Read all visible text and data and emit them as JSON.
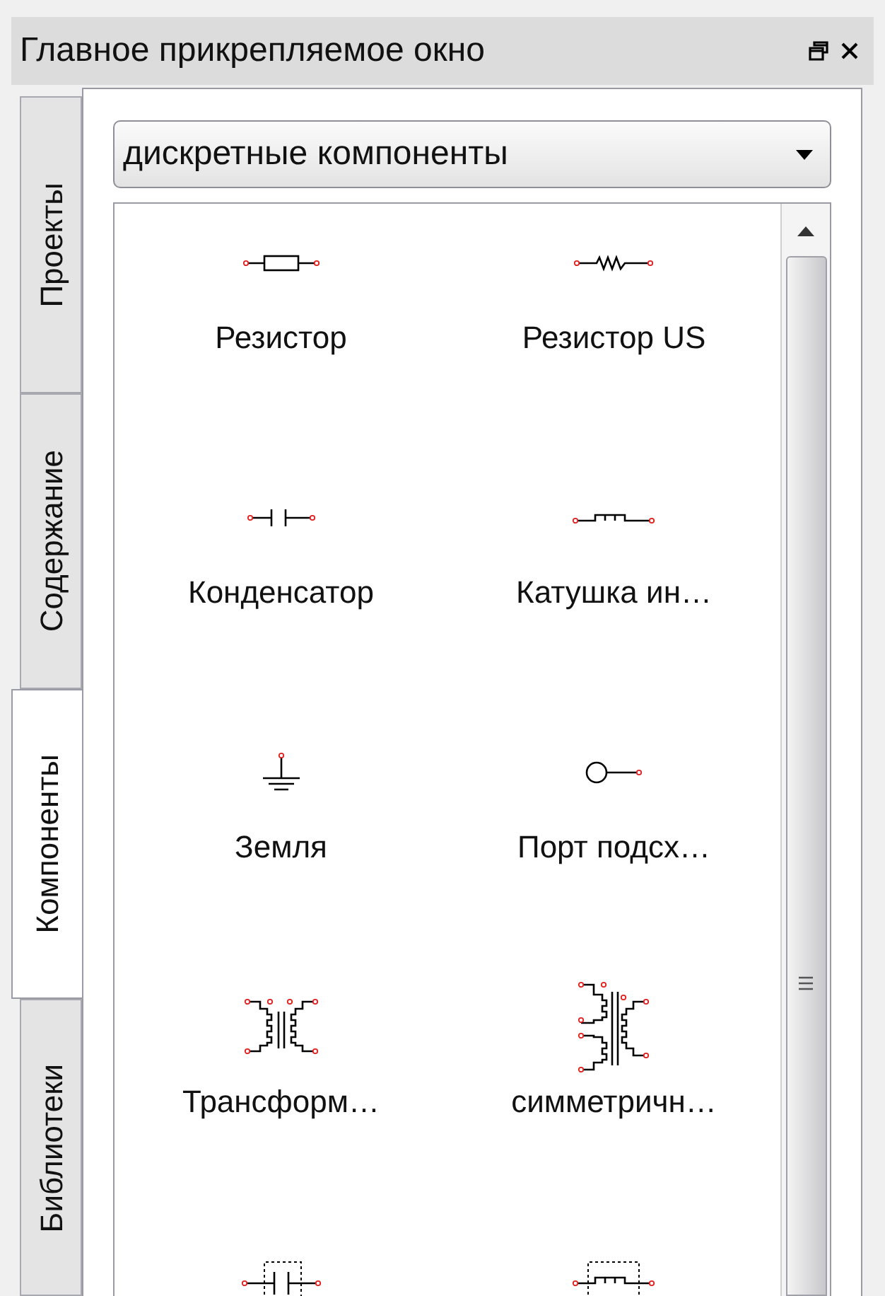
{
  "window": {
    "title": "Главное прикрепляемое окно"
  },
  "tabs": [
    {
      "label": "Проекты",
      "selected": false
    },
    {
      "label": "Содержание",
      "selected": false
    },
    {
      "label": "Компоненты",
      "selected": true
    },
    {
      "label": "Библиотеки",
      "selected": false
    }
  ],
  "category_select": {
    "value": "дискретные компоненты"
  },
  "components": [
    {
      "kind": "resistor",
      "label": "Резистор"
    },
    {
      "kind": "resistor-us",
      "label": "Резистор US"
    },
    {
      "kind": "capacitor",
      "label": "Конденсатор"
    },
    {
      "kind": "inductor",
      "label": "Катушка ин…"
    },
    {
      "kind": "ground",
      "label": "Земля"
    },
    {
      "kind": "port",
      "label": "Порт подсх…"
    },
    {
      "kind": "transformer",
      "label": "Трансформ…"
    },
    {
      "kind": "balun",
      "label": "симметричн…"
    },
    {
      "kind": "capacitor-box"
    },
    {
      "kind": "inductor-box"
    }
  ]
}
